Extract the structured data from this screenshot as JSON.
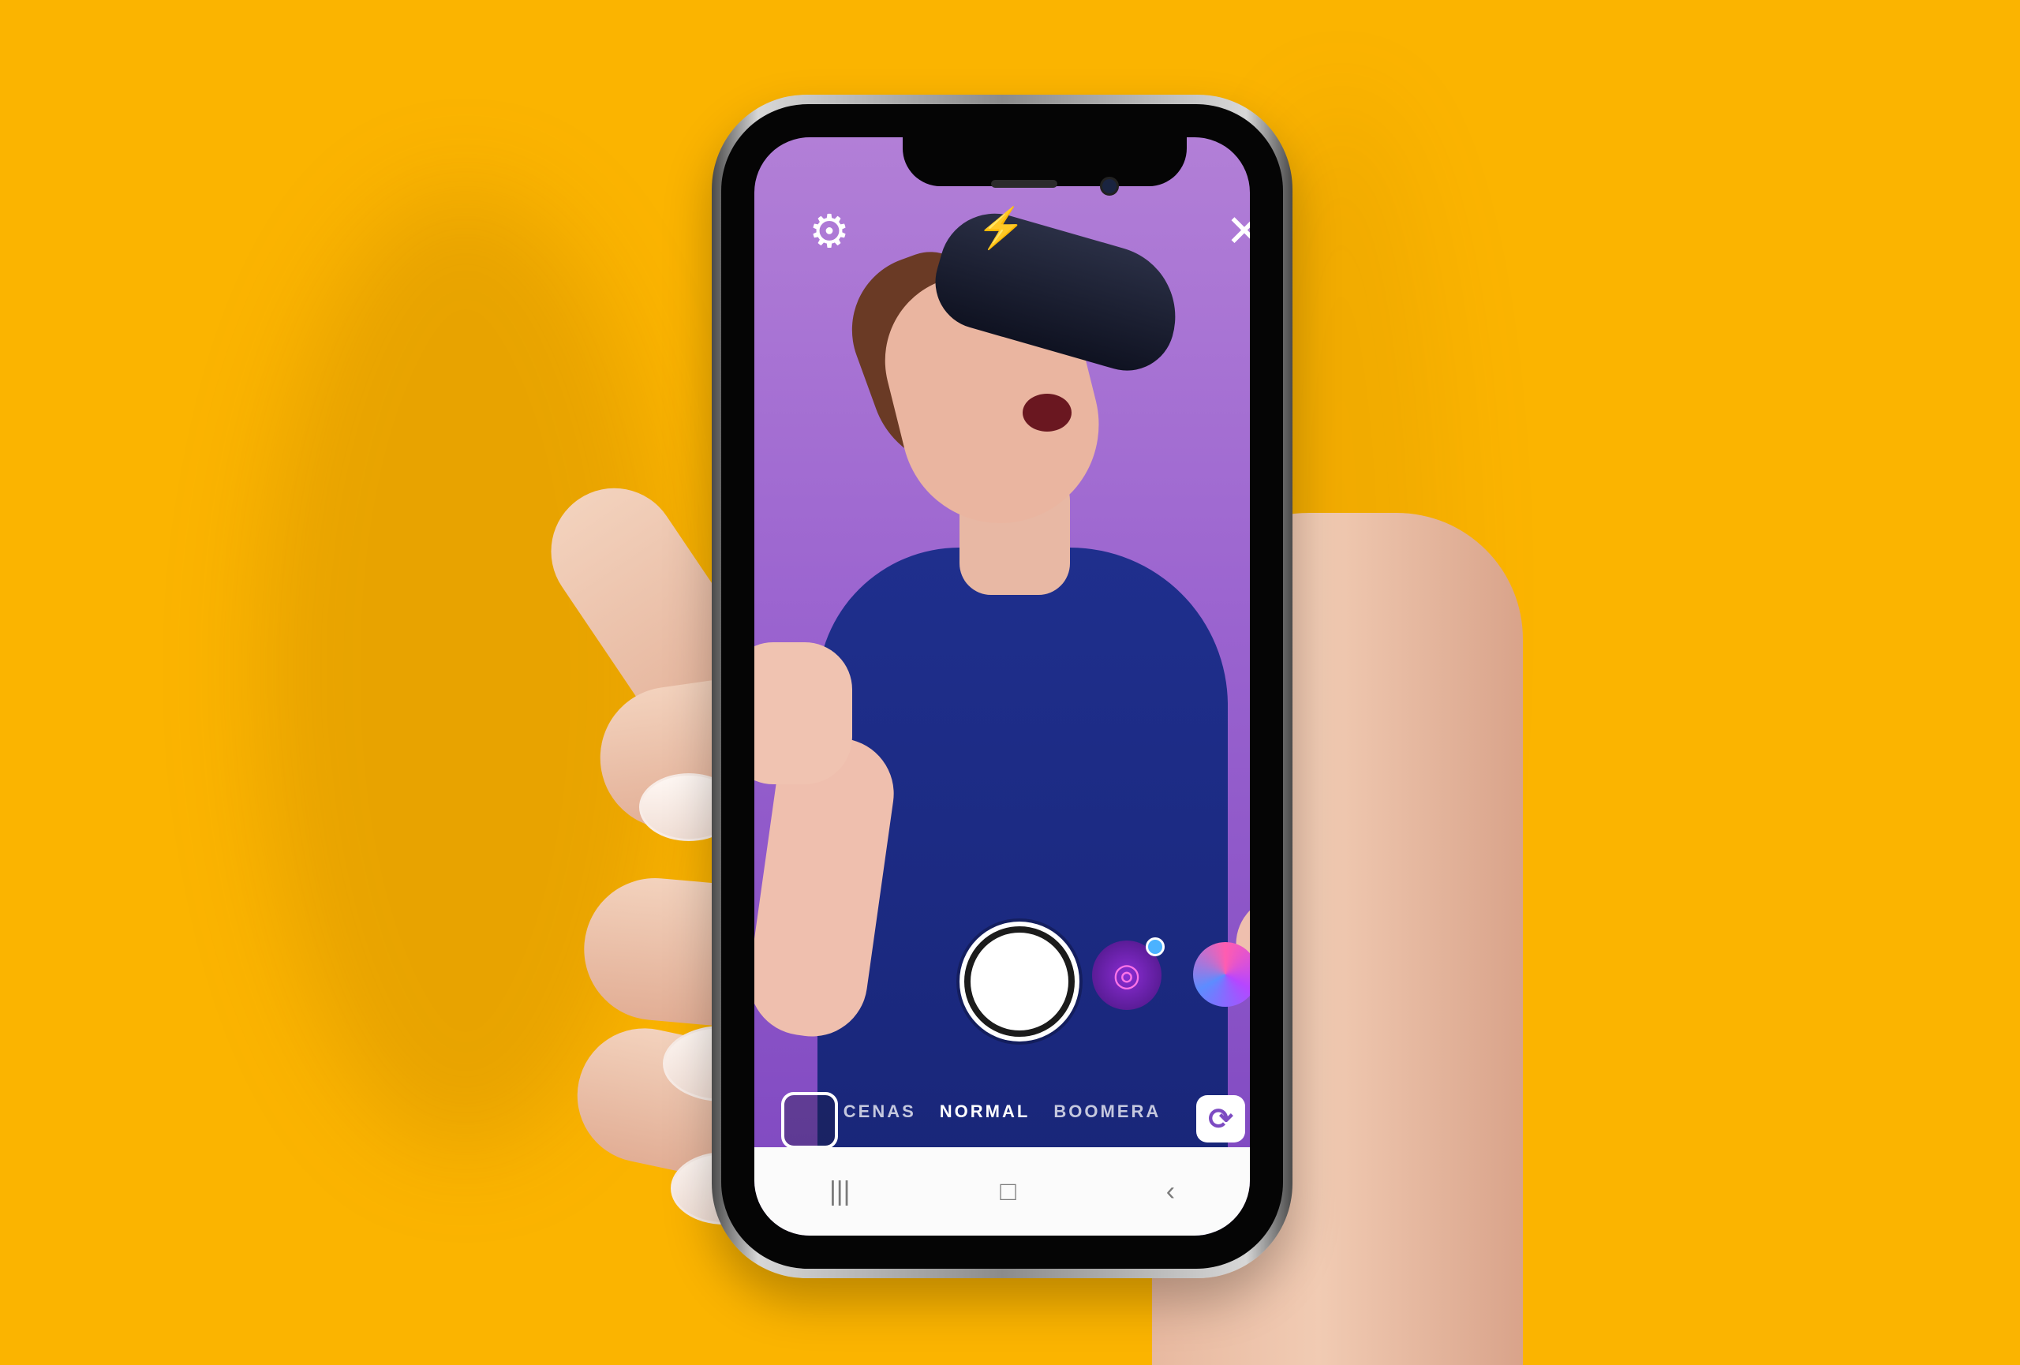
{
  "colors": {
    "background": "#FBB400",
    "screen_top": "#b27fd7",
    "screen_bottom": "#7e47c0",
    "shirt": "#1f2f8d"
  },
  "camera_ui": {
    "settings_icon": "gear-icon",
    "flash_icon": "flash-off-icon",
    "close_icon": "close-icon",
    "shutter_icon": "shutter-button",
    "filter_icon_1": "face-filter-icon",
    "filter_icon_2": "color-orb-icon",
    "gallery_icon": "gallery-thumbnail-icon",
    "modes": {
      "left": "CENAS",
      "active": "NORMAL",
      "right": "BOOMERA"
    },
    "flip_icon": "switch-camera-icon"
  },
  "system_nav": {
    "recent_icon": "recent-apps-icon",
    "home_icon": "home-icon",
    "back_icon": "back-icon"
  }
}
